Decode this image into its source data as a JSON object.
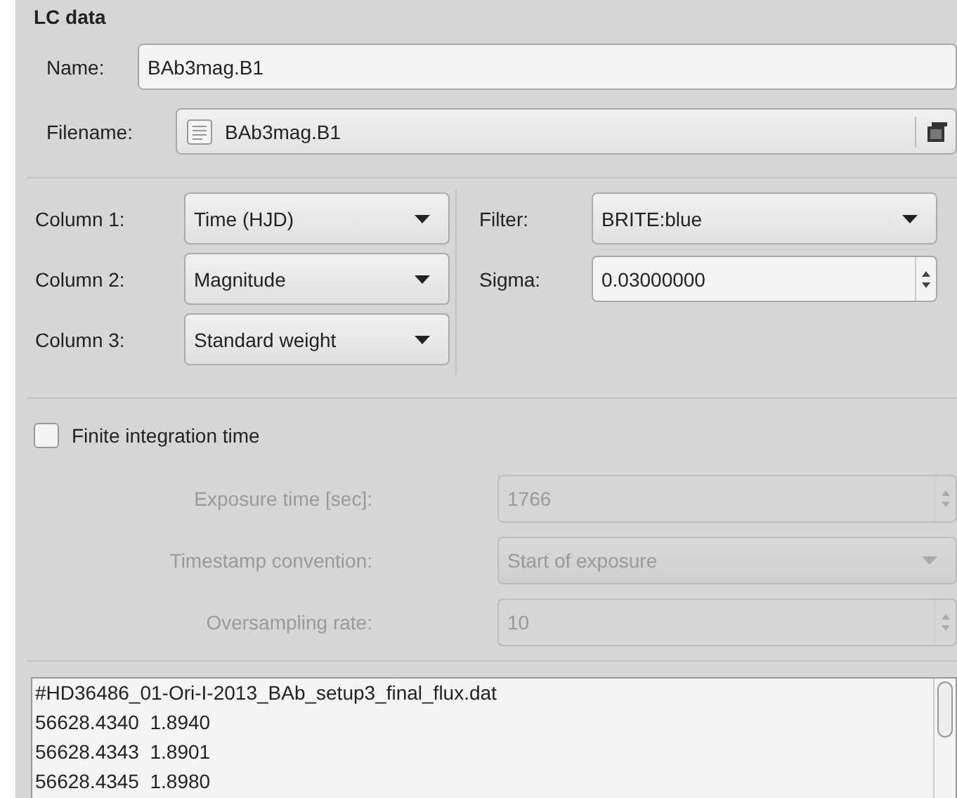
{
  "group_title": "LC data",
  "name": {
    "label": "Name:",
    "value": "BAb3mag.B1"
  },
  "filename": {
    "label": "Filename:",
    "value": "BAb3mag.B1"
  },
  "columns": [
    {
      "label": "Column 1:",
      "value": "Time (HJD)"
    },
    {
      "label": "Column 2:",
      "value": "Magnitude"
    },
    {
      "label": "Column 3:",
      "value": "Standard weight"
    }
  ],
  "filter": {
    "label": "Filter:",
    "value": "BRITE:blue"
  },
  "sigma": {
    "label": "Sigma:",
    "value": "0.03000000"
  },
  "finite_integration": {
    "label": "Finite integration time",
    "checked": false
  },
  "integration_fields": [
    {
      "kind": "spin",
      "label": "Exposure time [sec]:",
      "value": "1766",
      "disabled": true
    },
    {
      "kind": "combo",
      "label": "Timestamp convention:",
      "value": "Start of exposure",
      "disabled": true
    },
    {
      "kind": "spin",
      "label": "Oversampling rate:",
      "value": "10",
      "disabled": true
    }
  ],
  "preview_lines": [
    "#HD36486_01-Ori-I-2013_BAb_setup3_final_flux.dat",
    "56628.4340  1.8940",
    "56628.4343  1.8901",
    "56628.4345  1.8980"
  ]
}
